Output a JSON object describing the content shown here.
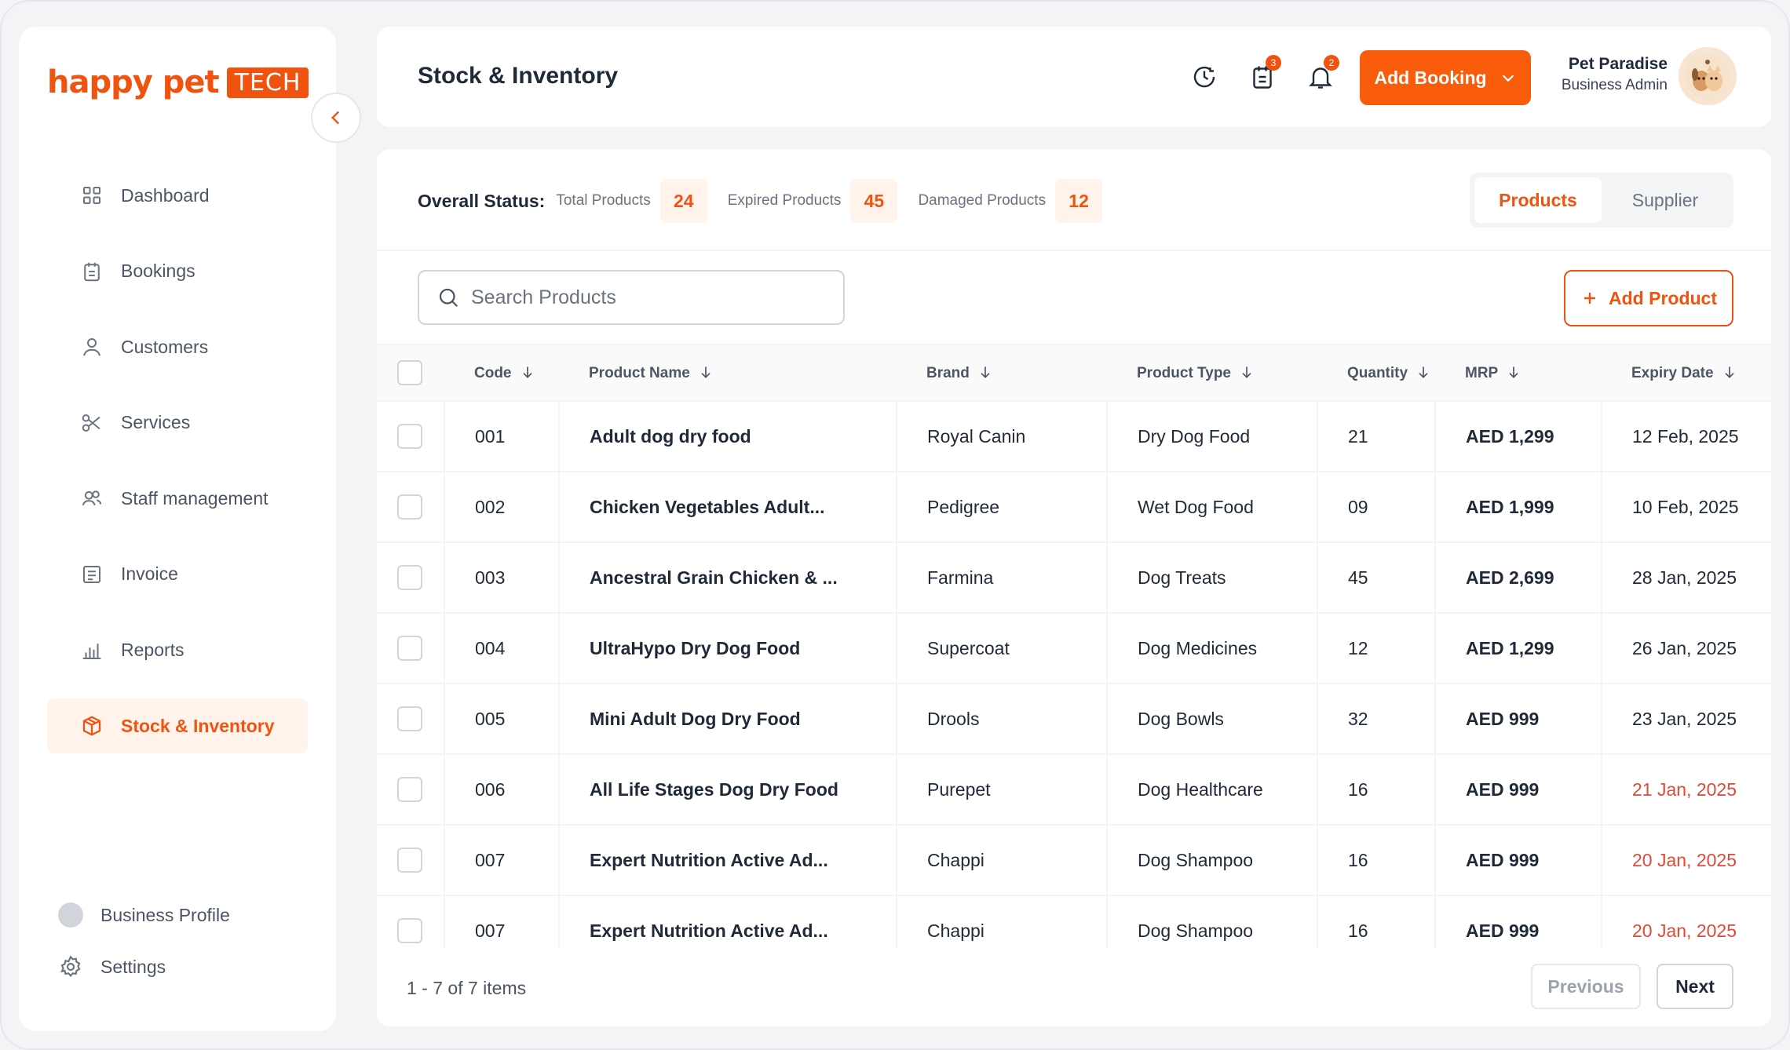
{
  "brand": {
    "name": "happy pet",
    "badge": "TECH"
  },
  "sidebar": {
    "items": [
      {
        "label": "Dashboard",
        "icon": "grid-icon"
      },
      {
        "label": "Bookings",
        "icon": "clipboard-icon"
      },
      {
        "label": "Customers",
        "icon": "user-icon"
      },
      {
        "label": "Services",
        "icon": "scissors-icon"
      },
      {
        "label": "Staff management",
        "icon": "users-icon"
      },
      {
        "label": "Invoice",
        "icon": "invoice-icon"
      },
      {
        "label": "Reports",
        "icon": "bar-chart-icon"
      },
      {
        "label": "Stock & Inventory",
        "icon": "box-icon",
        "active": true
      }
    ],
    "bottom": {
      "profile": "Business Profile",
      "settings": "Settings"
    }
  },
  "header": {
    "title": "Stock & Inventory",
    "tasks_badge": "3",
    "notifications_badge": "2",
    "add_booking": "Add Booking",
    "user_name": "Pet Paradise",
    "user_role": "Business Admin"
  },
  "status": {
    "title": "Overall Status:",
    "total_label": "Total Products",
    "total": "24",
    "expired_label": "Expired Products",
    "expired": "45",
    "damaged_label": "Damaged Products",
    "damaged": "12"
  },
  "tabs": {
    "products": "Products",
    "supplier": "Supplier"
  },
  "search": {
    "placeholder": "Search Products"
  },
  "add_product": "Add Product",
  "table": {
    "headers": [
      "Code",
      "Product Name",
      "Brand",
      "Product Type",
      "Quantity",
      "MRP",
      "Expiry Date"
    ],
    "rows": [
      {
        "code": "001",
        "name": "Adult dog dry food",
        "brand": "Royal Canin",
        "type": "Dry Dog Food",
        "qty": "21",
        "mrp": "AED 1,299",
        "expiry": "12 Feb, 2025",
        "expired": false
      },
      {
        "code": "002",
        "name": "Chicken Vegetables Adult...",
        "brand": "Pedigree",
        "type": "Wet Dog Food",
        "qty": "09",
        "mrp": "AED 1,999",
        "expiry": "10 Feb, 2025",
        "expired": false
      },
      {
        "code": "003",
        "name": "Ancestral Grain Chicken & ...",
        "brand": "Farmina",
        "type": "Dog Treats",
        "qty": "45",
        "mrp": "AED 2,699",
        "expiry": "28 Jan, 2025",
        "expired": false
      },
      {
        "code": "004",
        "name": "UltraHypo Dry Dog Food",
        "brand": "Supercoat",
        "type": "Dog Medicines",
        "qty": "12",
        "mrp": "AED 1,299",
        "expiry": "26 Jan, 2025",
        "expired": false
      },
      {
        "code": "005",
        "name": "Mini Adult Dog Dry Food",
        "brand": "Drools",
        "type": "Dog Bowls",
        "qty": "32",
        "mrp": "AED 999",
        "expiry": "23 Jan, 2025",
        "expired": false
      },
      {
        "code": "006",
        "name": "All Life Stages Dog Dry Food",
        "brand": "Purepet",
        "type": "Dog Healthcare",
        "qty": "16",
        "mrp": "AED 999",
        "expiry": "21 Jan, 2025",
        "expired": true
      },
      {
        "code": "007",
        "name": "Expert Nutrition Active Ad...",
        "brand": "Chappi",
        "type": "Dog Shampoo",
        "qty": "16",
        "mrp": "AED 999",
        "expiry": "20 Jan, 2025",
        "expired": true
      },
      {
        "code": "007",
        "name": "Expert Nutrition Active Ad...",
        "brand": "Chappi",
        "type": "Dog Shampoo",
        "qty": "16",
        "mrp": "AED 999",
        "expiry": "20 Jan, 2025",
        "expired": true
      }
    ]
  },
  "pagination": {
    "summary": "1 - 7 of 7 items",
    "previous": "Previous",
    "next": "Next"
  },
  "colors": {
    "accent": "#f0530f",
    "expired": "#e0493a"
  }
}
